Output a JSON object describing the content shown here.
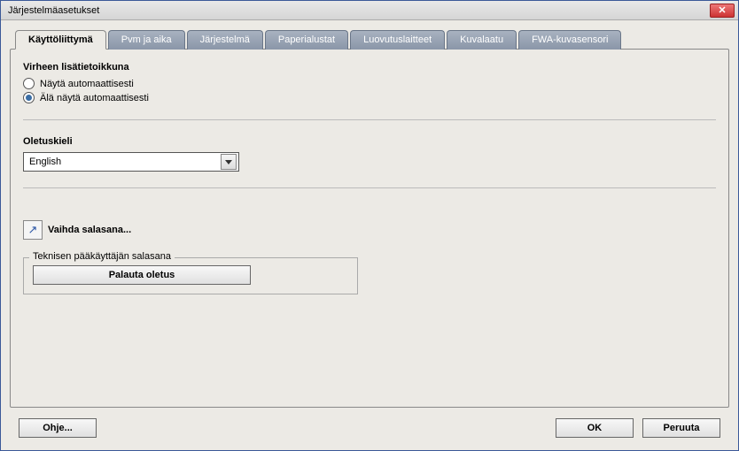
{
  "window": {
    "title": "Järjestelmäasetukset"
  },
  "tabs": [
    {
      "label": "Käyttöliittymä"
    },
    {
      "label": "Pvm ja aika"
    },
    {
      "label": "Järjestelmä"
    },
    {
      "label": "Paperialustat"
    },
    {
      "label": "Luovutuslaitteet"
    },
    {
      "label": "Kuvalaatu"
    },
    {
      "label": "FWA-kuvasensori"
    }
  ],
  "errorSection": {
    "title": "Virheen lisätietoikkuna",
    "option1": "Näytä automaattisesti",
    "option2": "Älä näytä automaattisesti"
  },
  "languageSection": {
    "title": "Oletuskieli",
    "value": "English"
  },
  "password": {
    "linkText": "Vaihda salasana...",
    "fieldsetTitle": "Teknisen pääkäyttäjän salasana",
    "resetButton": "Palauta oletus"
  },
  "footer": {
    "help": "Ohje...",
    "ok": "OK",
    "cancel": "Peruuta"
  }
}
